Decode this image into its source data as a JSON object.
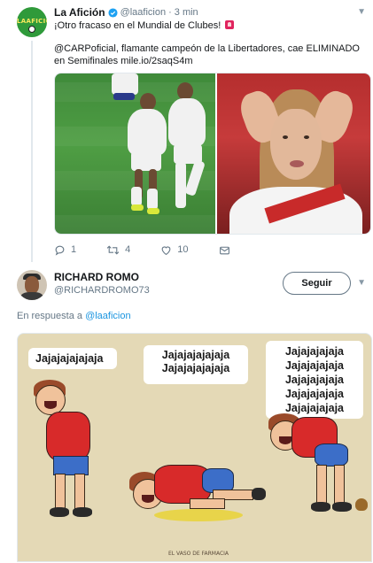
{
  "tweet1": {
    "name": "La Afición",
    "handle": "@laaficion",
    "separator": "·",
    "time": "3 min",
    "avatar_text": "LAAFICION",
    "text_line1": "¡Otro fracaso en el Mundial de Clubes!",
    "text_para2": "@CARPoficial, flamante campeón de la Libertadores, cae ELIMINADO en Semifinales mile.io/2saqS4m",
    "actions": {
      "replies": "1",
      "retweets": "4",
      "likes": "10"
    },
    "icons": [
      "verified-icon",
      "siren-emoji",
      "reply-icon",
      "retweet-icon",
      "like-icon",
      "share-icon",
      "caret-down-icon"
    ]
  },
  "tweet2": {
    "name": "RICHARD ROMO",
    "handle": "@RICHARDROMO73",
    "follow_label": "Seguir",
    "reply_prefix": "En respuesta a",
    "reply_mention": "@laaficion",
    "meme": {
      "bubble1": "Jajajajajajaja",
      "bubble2_line1": "Jajajajajajaja",
      "bubble2_line2": "Jajajajajajaja",
      "bubble3_line1": "Jajajajajaja",
      "bubble3_line2": "Jajajajajaja",
      "bubble3_line3": "Jajajajajaja",
      "bubble3_line4": "Jajajajajaja",
      "bubble3_line5": "Jajajajajaja",
      "credit": "EL VASO DE FARMACIA"
    }
  },
  "colors": {
    "link": "#1b95e0",
    "muted": "#657786",
    "verified": "#1da1f2",
    "border": "#e1e8ed"
  }
}
